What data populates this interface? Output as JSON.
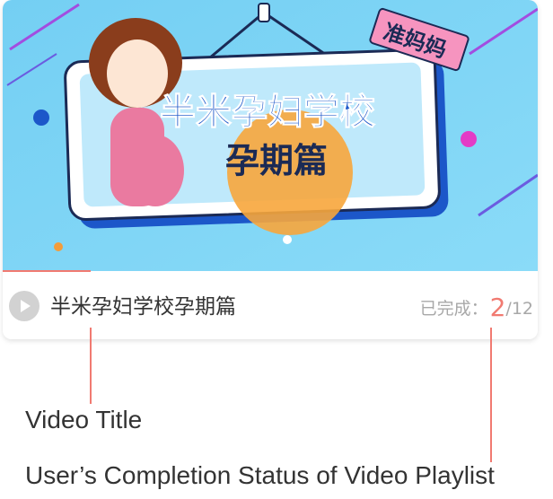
{
  "banner": {
    "main_text": "半米孕妇学校",
    "sub_text": "孕期篇",
    "badge_text": "准妈妈"
  },
  "card": {
    "title": "半米孕妇学校孕期篇",
    "completed_label": "已完成：",
    "completed_count": "2",
    "total": "/12"
  },
  "annotations": {
    "title_label": "Video Title",
    "status_label": "User’s Completion Status of Video Playlist"
  },
  "icons": {
    "play": "play-icon"
  },
  "colors": {
    "accent": "#f17a71",
    "banner_sky": "#8fd8f7",
    "board_frame": "#1c57c9"
  }
}
